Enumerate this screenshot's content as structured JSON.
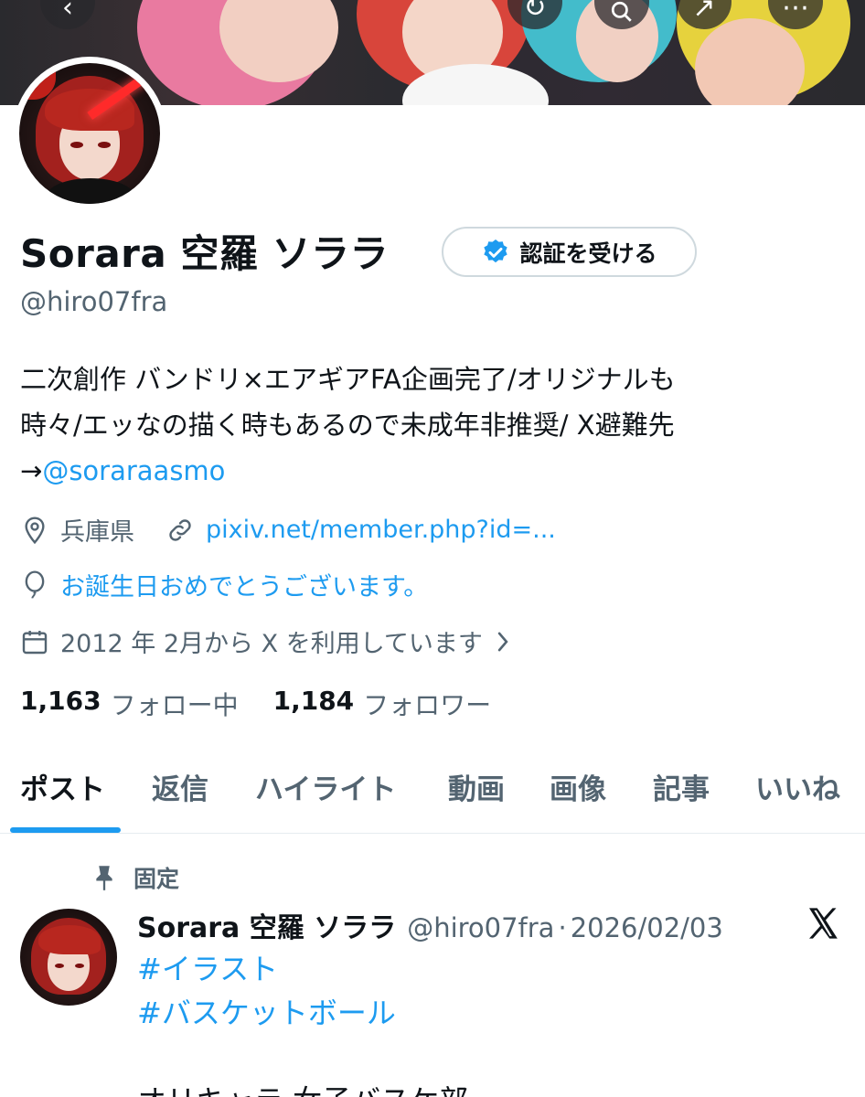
{
  "banner": {
    "back_icon": "chevron-left-icon",
    "search_icon": "search-icon",
    "colors": [
      "#e97aa0",
      "#e0453a",
      "#c83a32",
      "#3fb9c9",
      "#e6d23d"
    ]
  },
  "profile": {
    "display_name": "Sorara 空羅 ソララ",
    "verify_button_label": "認証を受ける",
    "handle": "@hiro07fra",
    "bio": {
      "line1": "二次創作 バンドリ×エアギアFA企画完了/オリジナルも",
      "line2": "時々/エッなの描く時もあるので未成年非推奨/ X避難先",
      "arrow": "→",
      "mention": "@soraraasmo"
    },
    "location": "兵庫県",
    "website": "pixiv.net/member.php?id=...",
    "birthday": "お誕生日おめでとうございます。",
    "joined": "2012 年 2月から X を利用しています",
    "following_count": "1,163",
    "following_label": "フォロー中",
    "followers_count": "1,184",
    "followers_label": "フォロワー"
  },
  "tabs": [
    {
      "label": "ポスト",
      "active": true
    },
    {
      "label": "返信"
    },
    {
      "label": "ハイライト"
    },
    {
      "label": "動画"
    },
    {
      "label": "画像"
    },
    {
      "label": "記事"
    },
    {
      "label": "いいね"
    }
  ],
  "pinned_post": {
    "pinned_label": "固定",
    "author_name": "Sorara 空羅 ソララ",
    "author_handle": "@hiro07fra",
    "separator": "·",
    "date": "2026/02/03",
    "hashtag1": "#イラスト",
    "hashtag2": "#バスケットボール",
    "body_line": "オリキャラ 女子バスケ部"
  },
  "colors": {
    "accent": "#1d9bf0",
    "text": "#0f1419",
    "secondary": "#536471"
  }
}
